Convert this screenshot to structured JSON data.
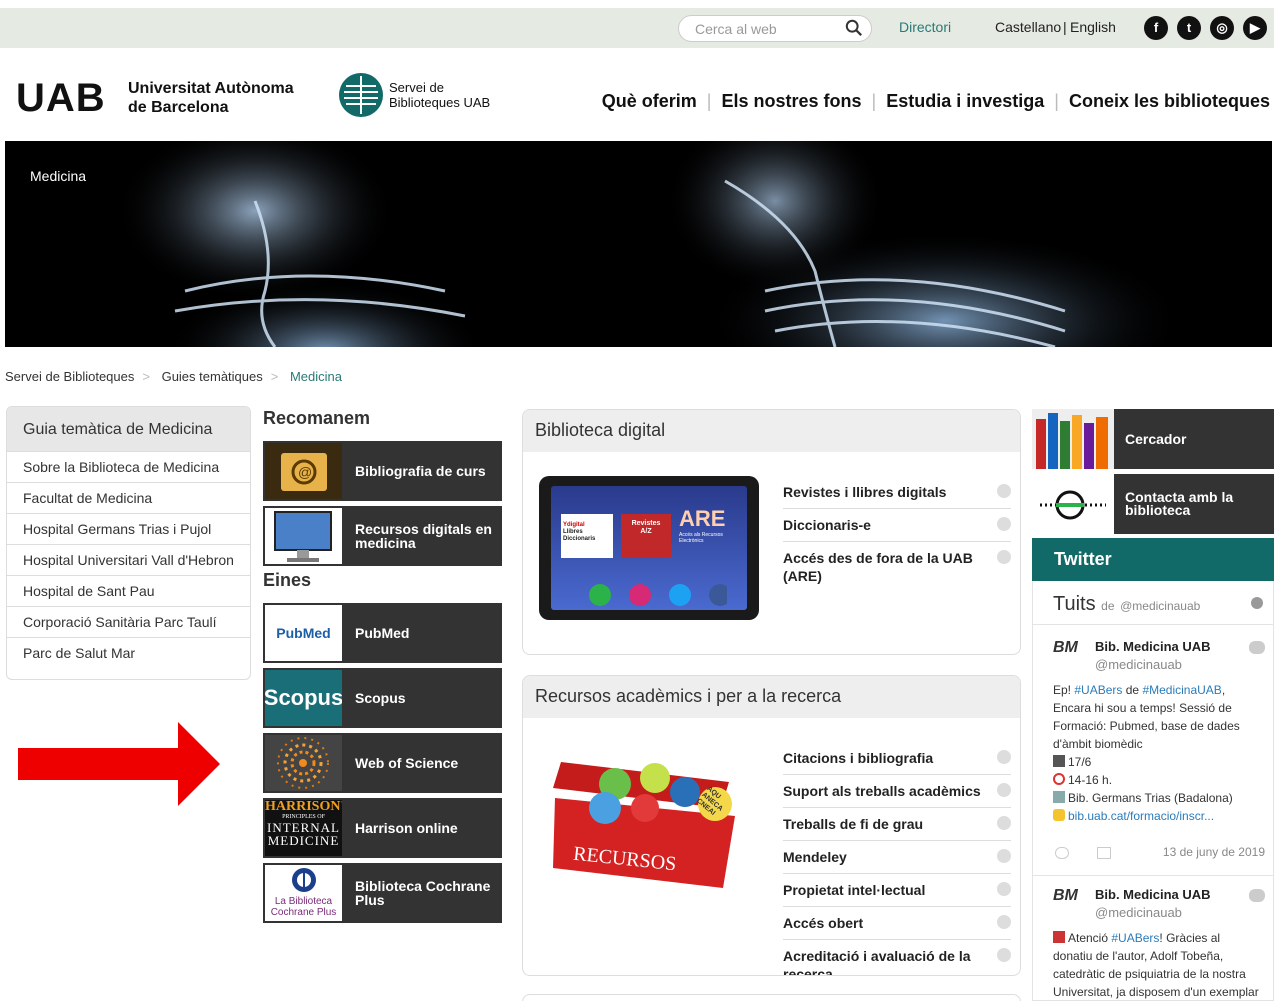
{
  "topbar": {
    "search_placeholder": "Cerca al web",
    "directory": "Directori",
    "lang_ca": "Castellano",
    "lang_sep": "|",
    "lang_en": "English",
    "social": [
      {
        "icon": "facebook-icon",
        "glyph": "f"
      },
      {
        "icon": "twitter-icon",
        "glyph": "t"
      },
      {
        "icon": "instagram-icon",
        "glyph": "◎"
      },
      {
        "icon": "youtube-icon",
        "glyph": "▶"
      }
    ]
  },
  "header": {
    "uab_mark": "UAB",
    "uab_line1": "Universitat Autònoma",
    "uab_line2": "de Barcelona",
    "sb_line1": "Servei de",
    "sb_line2": "Biblioteques UAB",
    "nav": [
      "Què oferim",
      "Els nostres fons",
      "Estudia i investiga",
      "Coneix les biblioteques"
    ]
  },
  "hero": {
    "label": "Medicina"
  },
  "breadcrumb": [
    "Servei de Biblioteques",
    "Guies temàtiques",
    "Medicina"
  ],
  "leftnav": {
    "title": "Guia temàtica de Medicina",
    "items": [
      "Sobre la Biblioteca de Medicina",
      "Facultat de Medicina",
      "Hospital Germans Trias i Pujol",
      "Hospital Universitari Vall d'Hebron",
      "Hospital de Sant Pau",
      "Corporació Sanitària Parc Taulí",
      "Parc de Salut Mar"
    ]
  },
  "recomanem": {
    "title": "Recomanem",
    "tiles": [
      "Bibliografia de curs",
      "Recursos digitals en medicina"
    ]
  },
  "eines": {
    "title": "Eines",
    "tiles": [
      "PubMed",
      "Scopus",
      "Web of Science",
      "Harrison online",
      "Biblioteca Cochrane Plus"
    ],
    "logos": {
      "pubmed": "PubMed",
      "scopus": "Scopus",
      "harrison_1": "HARRISON'S",
      "harrison_2": "PRINCIPLES OF",
      "harrison_3": "INTERNAL",
      "harrison_4": "MEDICINE",
      "cochrane_1": "La Biblioteca",
      "cochrane_2": "Cochrane Plus"
    }
  },
  "digital": {
    "title": "Biblioteca digital",
    "tablet": {
      "tile1_a": "Ydigital",
      "tile1_b": "Llibres",
      "tile1_c": "Diccionaris",
      "tile2_a": "Revistes",
      "tile2_b": "A/Z",
      "tile3_a": "ARE",
      "tile3_b": "Accés als Recursos Electrònics"
    },
    "links": [
      "Revistes i llibres digitals",
      "Diccionaris-e",
      "Accés des de fora de la UAB (ARE)"
    ]
  },
  "academic": {
    "title": "Recursos acadèmics i per a la recerca",
    "box_label": "RECURSOS",
    "badge": "AQU ANECA CNEAI",
    "links": [
      "Citacions i bibliografia",
      "Suport als treballs acadèmics",
      "Treballs de fi de grau",
      "Mendeley",
      "Propietat intel·lectual",
      "Accés obert",
      "Acreditació i avaluació de la recerca"
    ]
  },
  "right": {
    "cercador": "Cercador",
    "contacta": "Contacta amb la biblioteca",
    "twitter": "Twitter"
  },
  "tweets": {
    "header": "Tuits",
    "header_de": "de",
    "header_handle": "@medicinauab",
    "items": [
      {
        "avatar": "BM",
        "name": "Bib. Medicina UAB",
        "handle": "@medicinauab",
        "t1": "Ep!",
        "h1": "#UABers",
        "t2": "de",
        "h2": "#MedicinaUAB",
        "t3": ", Encara hi sou a temps! Sessió de Formació: Pubmed, base de dades d'àmbit biomèdic",
        "date_line": "17/6",
        "time_line": "14-16 h.",
        "place_line": "Bib. Germans Trias (Badalona)",
        "link": "bib.uab.cat/formacio/inscr...",
        "date": "13 de juny de 2019"
      },
      {
        "avatar": "BM",
        "name": "Bib. Medicina UAB",
        "handle": "@medicinauab",
        "t1": "Atenció",
        "h1": "#UABers",
        "t2": "! Gràcies al donatiu de l'autor, Adolf Tobeña, catedràtic de psiquiatria de la nostra Universitat, ja disposem d'un exemplar"
      }
    ]
  },
  "colors": {
    "teal": "#116a67",
    "dark": "#333333",
    "arrow": "#ee0000",
    "topbar": "#e5eae2"
  }
}
